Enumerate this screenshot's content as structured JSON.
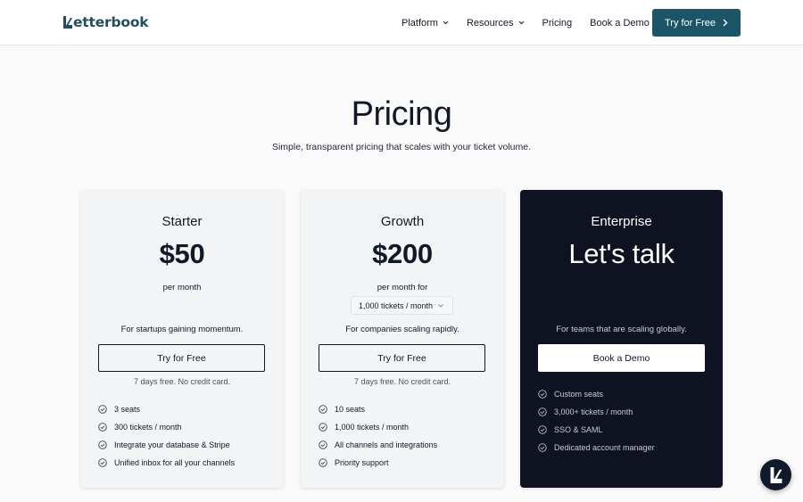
{
  "brand": {
    "logo_text": "etterbook",
    "logo_letter": "L",
    "color": "#1f4f5f"
  },
  "nav": {
    "items": [
      {
        "label": "Platform",
        "has_dropdown": true
      },
      {
        "label": "Resources",
        "has_dropdown": true
      },
      {
        "label": "Pricing",
        "has_dropdown": false
      },
      {
        "label": "Book a Demo",
        "has_dropdown": false
      }
    ],
    "cta_label": "Try for Free",
    "cta_color": "#1b5567"
  },
  "hero": {
    "title": "Pricing",
    "subtitle": "Simple, transparent pricing that scales with your ticket volume."
  },
  "plans": [
    {
      "name": "Starter",
      "price": "$50",
      "period": "per month",
      "description": "For startups gaining momentum.",
      "button": "Try for Free",
      "note": "7 days free. No credit card.",
      "features": [
        "3 seats",
        "300 tickets / month",
        "Integrate your database & Stripe",
        "Unified inbox for all your channels"
      ]
    },
    {
      "name": "Growth",
      "price": "$200",
      "period": "per month for",
      "select_value": "1,000 tickets / month",
      "description": "For companies scaling rapidly.",
      "button": "Try for Free",
      "note": "7 days free. No credit card.",
      "features": [
        "10 seats",
        "1,000 tickets / month",
        "All channels and integrations",
        "Priority support"
      ]
    },
    {
      "name": "Enterprise",
      "price": "Let's talk",
      "description": "For teams that are scaling globally.",
      "button": "Book a Demo",
      "features": [
        "Custom seats",
        "3,000+ tickets / month",
        "SSO & SAML",
        "Dedicated account manager"
      ]
    }
  ],
  "icons": {
    "check": "check-circle-icon",
    "chat": "chat-launcher-icon"
  },
  "colors": {
    "enterprise_bg": "#0f1220",
    "card_bg": "#f2f4f6"
  }
}
